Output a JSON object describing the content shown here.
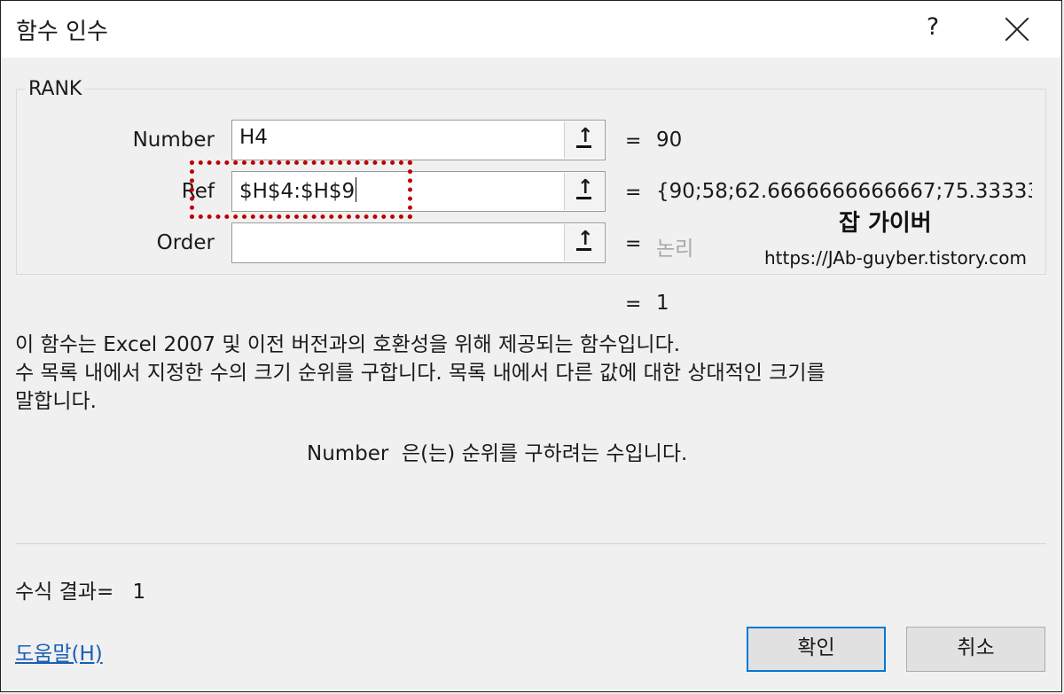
{
  "dialog": {
    "title": "함수 인수",
    "help": "?",
    "function_name": "RANK"
  },
  "arguments": [
    {
      "label": "Number",
      "value": "H4",
      "result": "90"
    },
    {
      "label": "Ref",
      "value": "$H$4:$H$9",
      "result": "{90;58;62.6666666666667;75.33333"
    },
    {
      "label": "Order",
      "value": "",
      "result": "논리"
    }
  ],
  "equals_sign": "=",
  "function_result": "1",
  "description": {
    "line1": "이 함수는 Excel 2007 및 이전 버전과의 호환성을 위해 제공되는 함수입니다.",
    "line2": "수 목록 내에서 지정한 수의 크기 순위를 구합니다. 목록 내에서 다른 값에 대한 상대적인 크기를",
    "line3": "말합니다.",
    "arg_help": "Number  은(는) 순위를 구하려는 수입니다."
  },
  "formula_result": {
    "label": "수식 결과=",
    "value": "1"
  },
  "help_link": "도움말(H)",
  "buttons": {
    "ok": "확인",
    "cancel": "취소"
  },
  "watermark": {
    "title": "잡 가이버",
    "url": "https://JAb-guyber.tistory.com"
  },
  "colors": {
    "highlight": "#c00000",
    "link": "#1a5fb4",
    "focus": "#0078d7",
    "placeholder": "#a8a8a8"
  },
  "icons": {
    "close": "close-icon",
    "collapse": "collapse-dialog-icon"
  }
}
